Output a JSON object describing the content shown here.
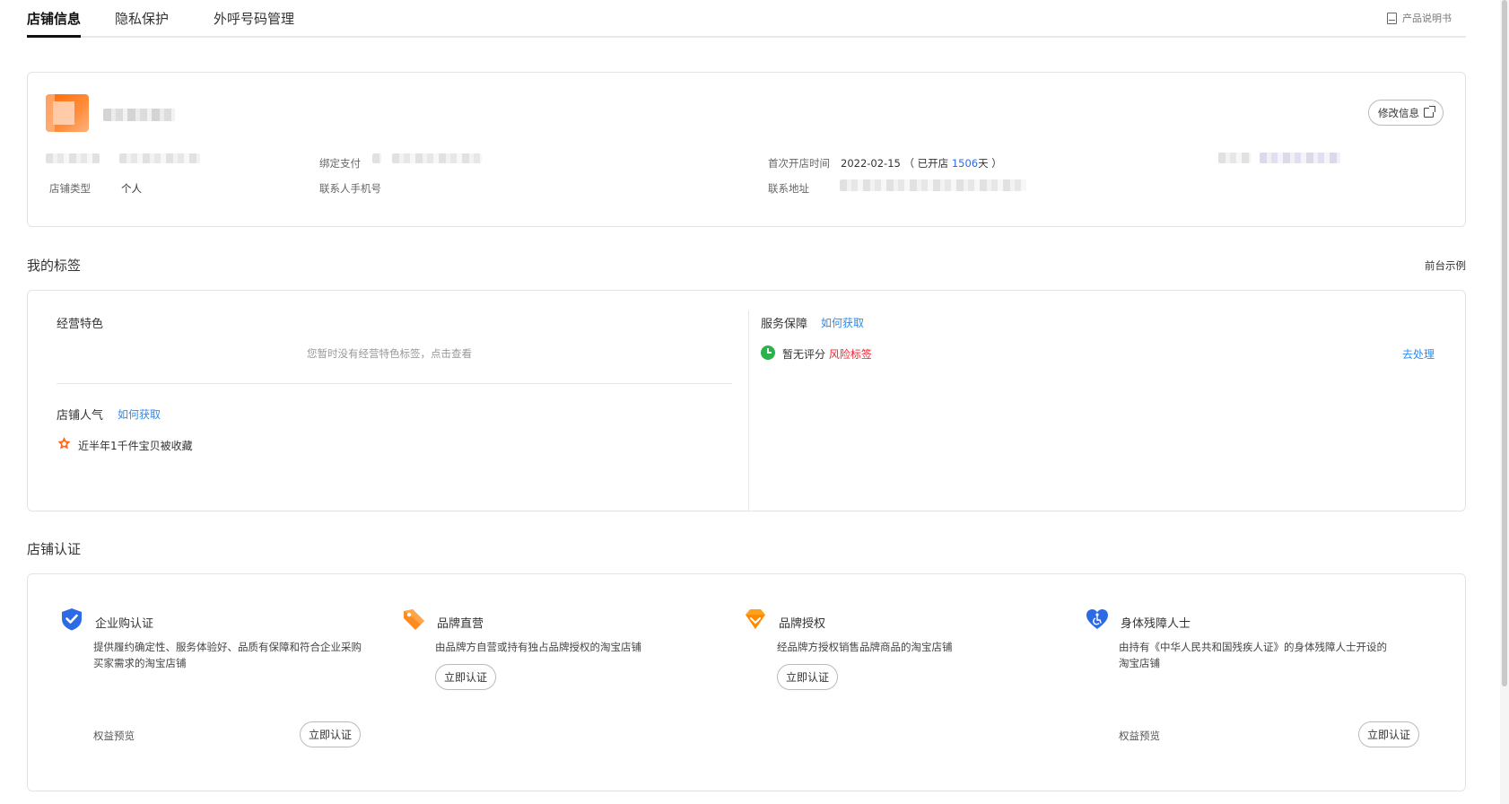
{
  "tabs": [
    {
      "label": "店铺信息",
      "active": true
    },
    {
      "label": "隐私保护",
      "active": false
    },
    {
      "label": "外呼号码管理",
      "active": false
    }
  ],
  "manual_label": "产品说明书",
  "shop": {
    "edit_label": "修改信息",
    "bind_alipay_label": "绑定支付",
    "shop_type_label": "店铺类型",
    "shop_type_value": "个人",
    "contact_phone_label": "联系人手机号",
    "first_open_label": "首次开店时间",
    "first_open_date": "2022-02-15",
    "opened_prefix": "（ 已开店 ",
    "opened_days": "1506",
    "opened_suffix": "天 ）",
    "address_label": "联系地址"
  },
  "tags_section": {
    "title": "我的标签",
    "front_example": "前台示例",
    "business_features": {
      "title": "经营特色",
      "empty_hint": "您暂时没有经营特色标签，点击查看"
    },
    "popularity": {
      "title": "店铺人气",
      "how_to_get": "如何获取",
      "item": "近半年1千件宝贝被收藏"
    },
    "service": {
      "title": "服务保障",
      "how_to_get": "如何获取",
      "status": "暂无评分",
      "risk_tag": "风险标签",
      "action": "去处理"
    }
  },
  "cert_section": {
    "title": "店铺认证",
    "items": [
      {
        "icon": "shield-check-icon",
        "name": "企业购认证",
        "desc": "提供履约确定性、服务体验好、品质有保障和符合企业采购买家需求的淘宝店铺",
        "rights": "权益预览",
        "button": "立即认证",
        "color": "#2d6ae6"
      },
      {
        "icon": "brand-tag-icon",
        "name": "品牌直营",
        "desc": "由品牌方自营或持有独占品牌授权的淘宝店铺",
        "rights": "",
        "button": "立即认证",
        "color": "#ff8a1f"
      },
      {
        "icon": "diamond-icon",
        "name": "品牌授权",
        "desc": "经品牌方授权销售品牌商品的淘宝店铺",
        "rights": "",
        "button": "立即认证",
        "color": "#ffa21a"
      },
      {
        "icon": "accessibility-heart-icon",
        "name": "身体残障人士",
        "desc": "由持有《中华人民共和国残疾人证》的身体残障人士开设的淘宝店铺",
        "rights": "权益预览",
        "button": "立即认证",
        "color": "#2d6ae6"
      }
    ]
  }
}
